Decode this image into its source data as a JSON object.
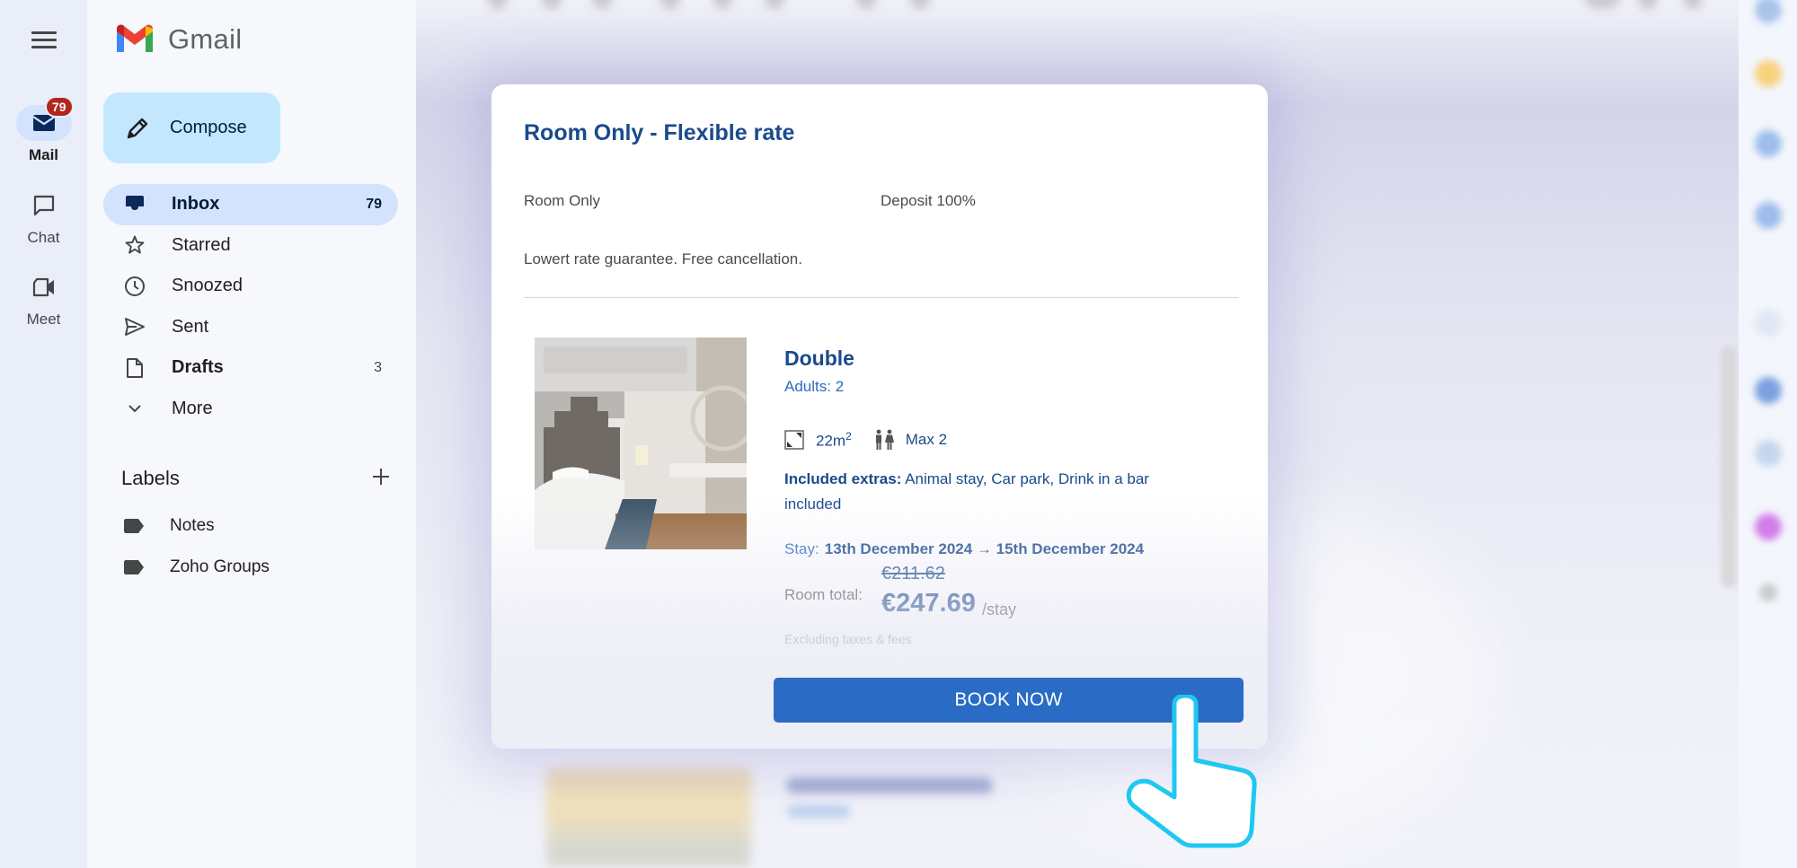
{
  "app": {
    "name": "Gmail"
  },
  "rail": {
    "items": [
      {
        "label": "Mail",
        "icon": "mail-icon",
        "badge": "79",
        "active": true
      },
      {
        "label": "Chat",
        "icon": "chat-icon"
      },
      {
        "label": "Meet",
        "icon": "video-icon"
      }
    ]
  },
  "compose": {
    "label": "Compose"
  },
  "nav": {
    "items": [
      {
        "label": "Inbox",
        "count": "79",
        "icon": "inbox-icon"
      },
      {
        "label": "Starred",
        "count": "",
        "icon": "star-icon"
      },
      {
        "label": "Snoozed",
        "count": "",
        "icon": "clock-icon"
      },
      {
        "label": "Sent",
        "count": "",
        "icon": "send-icon"
      },
      {
        "label": "Drafts",
        "count": "3",
        "icon": "draft-icon"
      },
      {
        "label": "More",
        "count": "",
        "icon": "chevron-down-icon"
      }
    ]
  },
  "labels": {
    "heading": "Labels",
    "items": [
      {
        "label": "Notes"
      },
      {
        "label": "Zoho Groups"
      }
    ]
  },
  "offer": {
    "rate_title": "Room Only - Flexible rate",
    "board": "Room Only",
    "deposit": "Deposit 100%",
    "description": "Lowert rate guarantee. Free cancellation.",
    "room": {
      "name": "Double",
      "adults": "Adults: 2",
      "size": "22m",
      "size_unit_sup": "2",
      "capacity": "Max 2",
      "extras_label": "Included extras:",
      "extras": "Animal stay, Car park, Drink in a bar included",
      "stay_label": "Stay:",
      "stay_dates": "13th December 2024 → 15th December 2024",
      "total_label": "Room total:",
      "old_price": "€211.62",
      "price": "€247.69",
      "price_unit": "/stay",
      "tax_note": "Excluding taxes & fees"
    },
    "book_button": "BOOK NOW"
  },
  "colors": {
    "brand_blue": "#1a4a8c",
    "link_blue": "#2d6bc4",
    "button_blue": "#2a6bc5",
    "badge_red": "#b3261e",
    "compose_bg": "#c2e7ff",
    "active_nav_bg": "#d3e3fd",
    "pointer_outline": "#1ec8f0"
  }
}
